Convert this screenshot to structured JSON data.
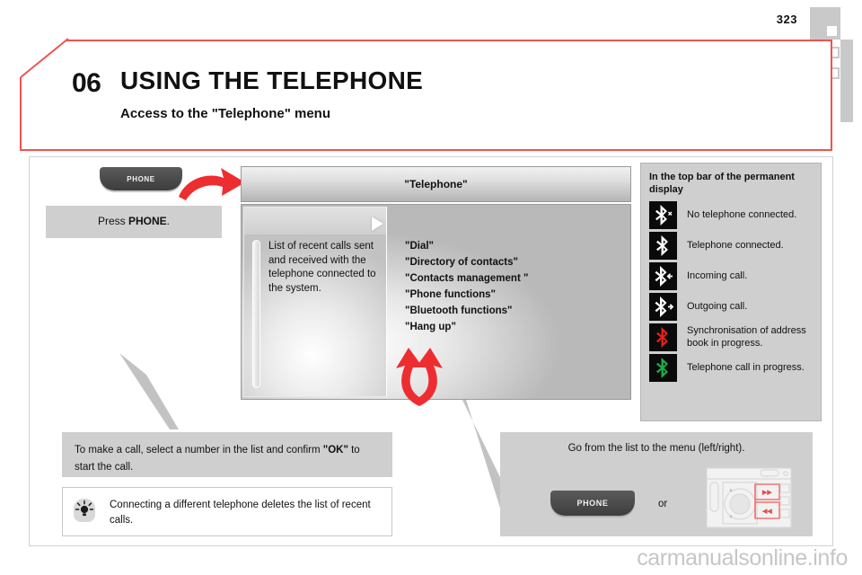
{
  "page": {
    "number": "323",
    "watermark": "carmanualsonline.info"
  },
  "header": {
    "chapter_number": "06",
    "title": "USING THE TELEPHONE",
    "subtitle": "Access to the \"Telephone\" menu",
    "accent_color": "#ef5350"
  },
  "left_column": {
    "phone_key_label": "PHONE",
    "press_instruction_prefix": "Press ",
    "press_instruction_bold": "PHONE",
    "press_instruction_suffix": ".",
    "call_note_prefix": "To make a call, select a number in the list and confirm ",
    "call_note_bold": "\"OK\"",
    "call_note_suffix": " to start the call.",
    "tip_icon": "lightbulb-icon",
    "tip_text": "Connecting a different telephone deletes the list of recent calls."
  },
  "screen": {
    "header_title": "\"Telephone\"",
    "left_pane_text": "List of recent calls sent and received with the telephone connected to the system.",
    "play_icon": "play-triangle-icon",
    "scrollbar": "vertical-scrollbar",
    "menu_items": [
      "\"Dial\"",
      "\"Directory of contacts\"",
      "\"Contacts management \"",
      "\"Phone functions\"",
      "\"Bluetooth functions\"",
      "\"Hang up\""
    ]
  },
  "status_panel": {
    "title": "In the top bar of the permanent display",
    "rows": [
      {
        "icon": "bluetooth-no-phone-icon",
        "color": "#ffffff",
        "mark": "x",
        "label": "No telephone connected."
      },
      {
        "icon": "bluetooth-connected-icon",
        "color": "#ffffff",
        "mark": "",
        "label": "Telephone connected."
      },
      {
        "icon": "bluetooth-incoming-call-icon",
        "color": "#ffffff",
        "mark": "left-arrow",
        "label": "Incoming call."
      },
      {
        "icon": "bluetooth-outgoing-call-icon",
        "color": "#ffffff",
        "mark": "right-arrow",
        "label": "Outgoing call."
      },
      {
        "icon": "bluetooth-sync-icon",
        "color": "#e32119",
        "mark": "",
        "label": "Synchronisation of address book in progress."
      },
      {
        "icon": "bluetooth-in-call-icon",
        "color": "#1faa4b",
        "mark": "",
        "label": "Telephone call in progress."
      }
    ]
  },
  "nav_box": {
    "heading": "Go from the list to the menu (left/right).",
    "phone_key_label": "PHONE",
    "or_label": "or",
    "panel_icon": "car-audio-control-panel-icon"
  },
  "annotations": {
    "red_arrow_to_screen": "curved-red-arrow-icon",
    "red_double_arrow": "double-curved-red-arrow-icon"
  }
}
